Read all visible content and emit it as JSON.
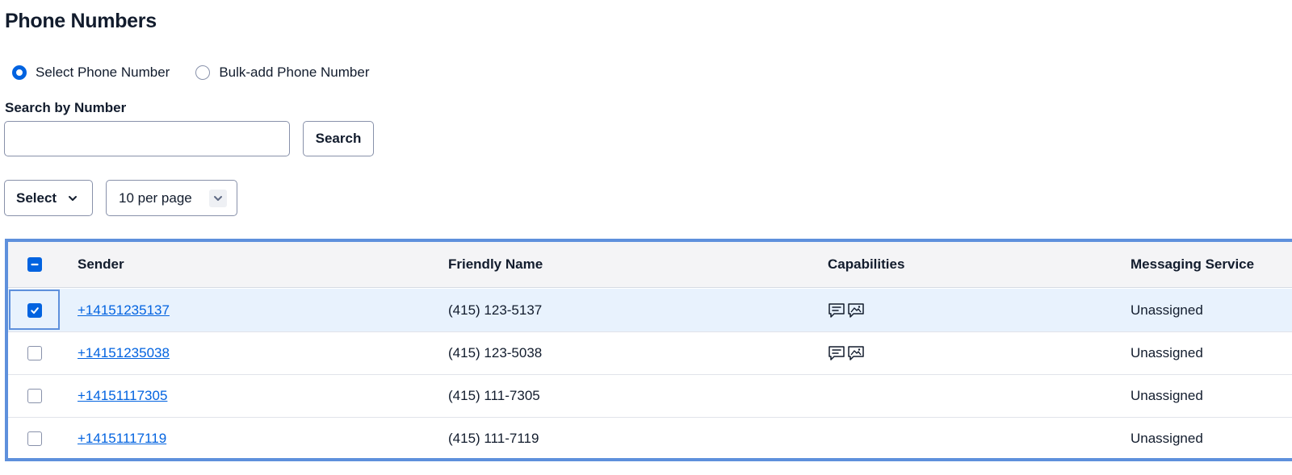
{
  "page": {
    "title": "Phone Numbers"
  },
  "mode": {
    "options": [
      {
        "label": "Select Phone Number",
        "checked": true
      },
      {
        "label": "Bulk-add Phone Number",
        "checked": false
      }
    ]
  },
  "search": {
    "label": "Search by Number",
    "value": "",
    "placeholder": "",
    "button_label": "Search"
  },
  "controls": {
    "select_label": "Select",
    "per_page": "10 per page"
  },
  "table": {
    "headers": {
      "sender": "Sender",
      "friendly_name": "Friendly Name",
      "capabilities": "Capabilities",
      "messaging_service": "Messaging Service"
    },
    "header_checkbox": "indeterminate",
    "rows": [
      {
        "sender": "+14151235137",
        "friendly_name": "(415) 123-5137",
        "capabilities": [
          "sms-icon",
          "mms-icon"
        ],
        "messaging_service": "Unassigned",
        "checked": true
      },
      {
        "sender": "+14151235038",
        "friendly_name": "(415) 123-5038",
        "capabilities": [
          "sms-icon",
          "mms-icon"
        ],
        "messaging_service": "Unassigned",
        "checked": false
      },
      {
        "sender": "+14151117305",
        "friendly_name": "(415) 111-7305",
        "capabilities": [],
        "messaging_service": "Unassigned",
        "checked": false
      },
      {
        "sender": "+14151117119",
        "friendly_name": "(415) 111-7119",
        "capabilities": [],
        "messaging_service": "Unassigned",
        "checked": false
      }
    ]
  },
  "colors": {
    "accent": "#0263e0",
    "selected_row": "#e8f2fd",
    "table_border": "#5e90dc",
    "header_bg": "#f4f4f6",
    "text": "#121c2d"
  }
}
